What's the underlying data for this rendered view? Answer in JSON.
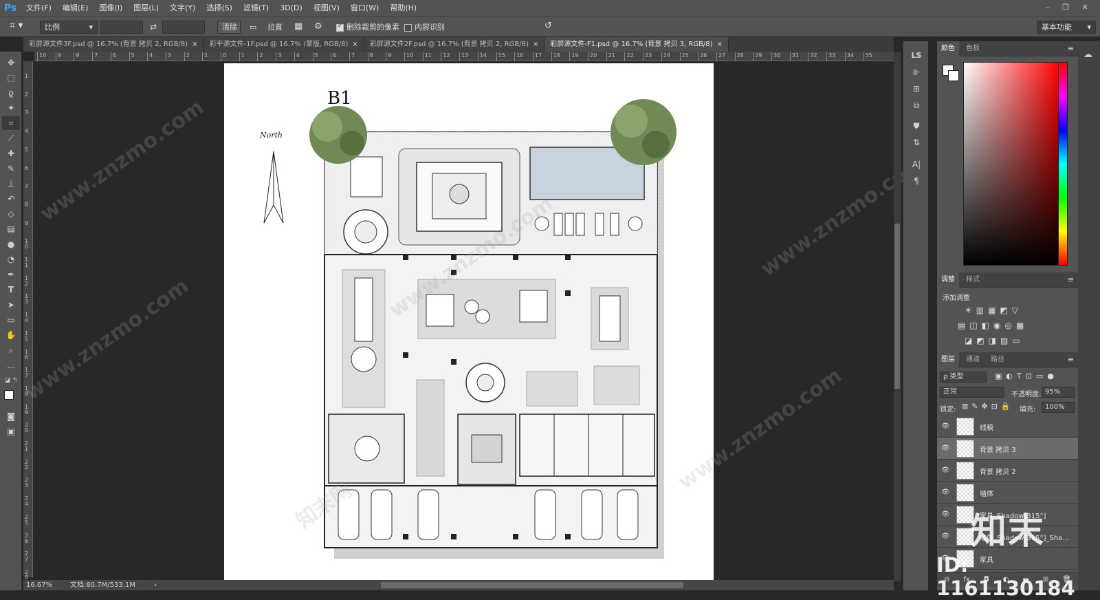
{
  "app": {
    "logo": "Ps"
  },
  "menu": [
    "文件(F)",
    "编辑(E)",
    "图像(I)",
    "图层(L)",
    "文字(Y)",
    "选择(S)",
    "滤镜(T)",
    "3D(D)",
    "视图(V)",
    "窗口(W)",
    "帮助(H)"
  ],
  "window_controls": {
    "minimize": "–",
    "restore": "❐",
    "close": "✕"
  },
  "options": {
    "ratio_select": "比例",
    "swap_icon": "⇄",
    "clear_button": "清除",
    "straighten_label": "拉直",
    "delete_cropped_label": "删除裁剪的像素",
    "delete_cropped_checked": true,
    "content_aware_label": "内容识别",
    "content_aware_checked": false,
    "workspace": "基本功能"
  },
  "tabs": [
    {
      "label": "彩屏源文件3F.psd @ 16.7% (背景 拷贝 2, RGB/8)",
      "active": false
    },
    {
      "label": "彩平源文件-1F.psd @ 16.7% (蒙版, RGB/8)",
      "active": false
    },
    {
      "label": "彩屏源文件2F.psd @ 16.7% (背景 拷贝 2, RGB/8)",
      "active": false
    },
    {
      "label": "彩屏源文件-F1.psd @ 16.7% (背景 拷贝 3, RGB/8)",
      "active": true
    }
  ],
  "tab_close": "×",
  "ruler_top_labels": [
    "10",
    "9",
    "8",
    "7",
    "6",
    "5",
    "4",
    "3",
    "2",
    "1",
    "0",
    "1",
    "2",
    "3",
    "4",
    "5",
    "6",
    "7",
    "8",
    "9",
    "10",
    "11",
    "12",
    "13",
    "14",
    "15",
    "16",
    "17",
    "18",
    "19",
    "20",
    "21",
    "22",
    "23",
    "24",
    "25",
    "26",
    "27",
    "28",
    "29",
    "30",
    "31",
    "32",
    "33",
    "34",
    "35"
  ],
  "ruler_left_labels": [
    "1",
    "2",
    "3",
    "4",
    "5",
    "6",
    "7",
    "8",
    "9",
    "1 0",
    "1 1",
    "1 2",
    "1 3",
    "1 4",
    "1 5",
    "1 6",
    "1 7",
    "1 8",
    "1 9",
    "2 0",
    "2 1",
    "2 2",
    "2 3",
    "2 4",
    "2 5",
    "2 6",
    "2 7",
    "2 8"
  ],
  "document": {
    "title": "B1",
    "north_label": "North"
  },
  "status": {
    "zoom": "16.67%",
    "doc_info": "文档:80.7M/533.1M"
  },
  "color_panel": {
    "tabs": [
      "颜色",
      "色板"
    ],
    "fg_color": "#ffffff",
    "bg_color": "#ffffff"
  },
  "adjust_panel": {
    "tabs": [
      "调整",
      "样式"
    ],
    "add_label": "添加调整"
  },
  "layers_panel": {
    "tabs": [
      "图层",
      "通道",
      "路径"
    ],
    "filter_kind": "ρ 类型",
    "blend_mode": "正常",
    "opacity_label": "不透明度:",
    "opacity_value": "95%",
    "lock_label": "锁定:",
    "fill_label": "填充:",
    "fill_value": "100%",
    "layers": [
      {
        "name": "线稿",
        "selected": false
      },
      {
        "name": "背景 拷贝 3",
        "selected": true
      },
      {
        "name": "背景 拷贝 2",
        "selected": false
      },
      {
        "name": "墙体",
        "selected": false
      },
      {
        "name": "家具_Shadow[315°]",
        "selected": false
      },
      {
        "name": "墙体_Shadow[315°]_Sha...",
        "selected": false
      },
      {
        "name": "家具",
        "selected": false
      }
    ],
    "footer_icons": [
      "⊖",
      "fx",
      "◘",
      "◐",
      "▬",
      "⊞",
      "🗑"
    ]
  },
  "watermark": {
    "brand": "知末",
    "id_text": "ID: 1161130184",
    "url": "www.znzmo.com",
    "site": "知末网"
  }
}
